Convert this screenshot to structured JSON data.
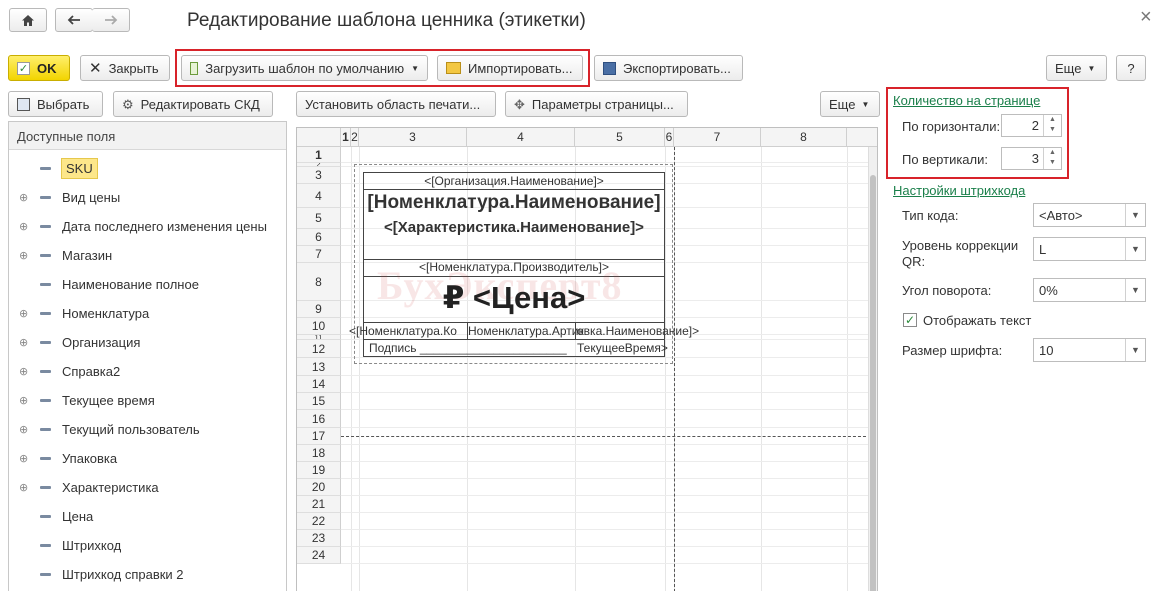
{
  "window": {
    "title": "Редактирование шаблона ценника (этикетки)",
    "close_glyph": "×"
  },
  "nav": {
    "home_icon": "home-icon",
    "back_icon": "arrow-left-icon",
    "forward_icon": "arrow-right-icon"
  },
  "toolbar": {
    "ok": "OK",
    "close": "Закрыть",
    "load_default": "Загрузить шаблон по умолчанию",
    "import": "Импортировать...",
    "export": "Экспортировать...",
    "more": "Еще",
    "help": "?"
  },
  "left_toolbar": {
    "select": "Выбрать",
    "edit_skd": "Редактировать СКД"
  },
  "sheet_toolbar": {
    "set_print_area": "Установить область печати...",
    "page_params": "Параметры страницы...",
    "more": "Еще"
  },
  "tree": {
    "header": "Доступные поля",
    "items": [
      {
        "label": "SKU",
        "expandable": false,
        "selected": true
      },
      {
        "label": "Вид цены",
        "expandable": true
      },
      {
        "label": "Дата последнего изменения цены",
        "expandable": true
      },
      {
        "label": "Магазин",
        "expandable": true
      },
      {
        "label": "Наименование полное",
        "expandable": false
      },
      {
        "label": "Номенклатура",
        "expandable": true
      },
      {
        "label": "Организация",
        "expandable": true
      },
      {
        "label": "Справка2",
        "expandable": true
      },
      {
        "label": "Текущее время",
        "expandable": true
      },
      {
        "label": "Текущий пользователь",
        "expandable": true
      },
      {
        "label": "Упаковка",
        "expandable": true
      },
      {
        "label": "Характеристика",
        "expandable": true
      },
      {
        "label": "Цена",
        "expandable": false
      },
      {
        "label": "Штрихкод",
        "expandable": false
      },
      {
        "label": "Штрихкод справки 2",
        "expandable": false
      }
    ]
  },
  "sheet": {
    "columns": [
      "1",
      "2",
      "3",
      "4",
      "5",
      "6",
      "7",
      "8"
    ],
    "rows": [
      "1",
      "2",
      "3",
      "4",
      "5",
      "6",
      "7",
      "8",
      "9",
      "10",
      "11",
      "12",
      "13",
      "14",
      "15",
      "16",
      "17",
      "18",
      "19",
      "20",
      "21",
      "22",
      "23",
      "24"
    ],
    "org_name": "<[Организация.Наименование]>",
    "nom_name": "[Номенклатура.Наименование]",
    "char_name": "<[Характеристика.Наименование]>",
    "manufacturer": "<[Номенклатура.Производитель]>",
    "price": "₽ <Цена>",
    "article_row": "<[Номенклатура.Ко|Номенклатура.Артик|овка.Наименование]>",
    "article_a": "<[Номенклатура.Ко",
    "article_b": "Номенклатура.Артик",
    "article_c": "овка.Наименование]>",
    "signature": "Подпись ______________________",
    "current_time": "ТекущееВремя>",
    "watermark": "БухЭксперт8"
  },
  "per_page": {
    "title": "Количество на странице",
    "horizontal_label": "По горизонтали:",
    "horizontal_value": "2",
    "vertical_label": "По вертикали:",
    "vertical_value": "3"
  },
  "barcode": {
    "title": "Настройки штрихкода",
    "code_type_label": "Тип кода:",
    "code_type_value": "<Авто>",
    "correction_label_1": "Уровень коррекции",
    "correction_label_2": "QR:",
    "correction_value": "L",
    "rotation_label": "Угол поворота:",
    "rotation_value": "0%",
    "show_text_label": "Отображать текст",
    "show_text_checked": true,
    "font_size_label": "Размер шрифта:",
    "font_size_value": "10"
  },
  "colors": {
    "accent_red": "#d8232a",
    "link_green": "#1a7f4a",
    "ok_yellow": "#f2d400"
  }
}
